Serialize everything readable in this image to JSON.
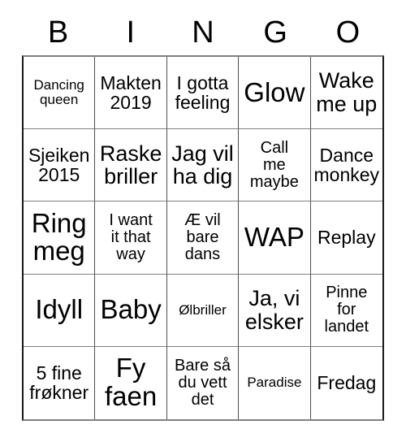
{
  "card": {
    "header_letters": [
      "B",
      "I",
      "N",
      "G",
      "O"
    ],
    "columns": 5,
    "rows": 5,
    "colors": {
      "background": "#ffffff",
      "text": "#000000",
      "grid_line": "#808080",
      "grid_border": "#1a1a1a"
    },
    "cells": [
      {
        "text": "Dancing\nqueen",
        "size": "sm"
      },
      {
        "text": "Makten\n2019",
        "size": "lg"
      },
      {
        "text": "I gotta\nfeeling",
        "size": "lg"
      },
      {
        "text": "Glow",
        "size": "xxl"
      },
      {
        "text": "Wake\nme up",
        "size": "xl"
      },
      {
        "text": "Sjeiken\n2015",
        "size": "lg"
      },
      {
        "text": "Raske\nbriller",
        "size": "xl"
      },
      {
        "text": "Jag vil\nha dig",
        "size": "xl"
      },
      {
        "text": "Call\nme\nmaybe",
        "size": "md"
      },
      {
        "text": "Dance\nmonkey",
        "size": "lg"
      },
      {
        "text": "Ring\nmeg",
        "size": "xxl"
      },
      {
        "text": "I want\nit that\nway",
        "size": "md"
      },
      {
        "text": "Æ vil\nbare\ndans",
        "size": "md"
      },
      {
        "text": "WAP",
        "size": "xxl"
      },
      {
        "text": "Replay",
        "size": "lg"
      },
      {
        "text": "Idyll",
        "size": "xxl"
      },
      {
        "text": "Baby",
        "size": "xxl"
      },
      {
        "text": "Ølbriller",
        "size": "sm"
      },
      {
        "text": "Ja, vi\nelsker",
        "size": "xl"
      },
      {
        "text": "Pinne\nfor\nlandet",
        "size": "md"
      },
      {
        "text": "5 fine\nfrøkner",
        "size": "lg"
      },
      {
        "text": "Fy\nfaen",
        "size": "xxl"
      },
      {
        "text": "Bare så\ndu vett\ndet",
        "size": "md"
      },
      {
        "text": "Paradise",
        "size": "sm"
      },
      {
        "text": "Fredag",
        "size": "lg"
      }
    ]
  }
}
